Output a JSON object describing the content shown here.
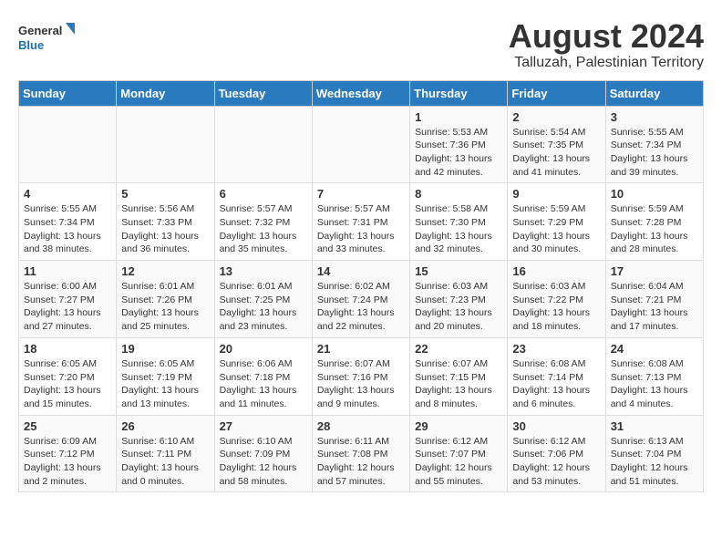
{
  "logo": {
    "line1": "General",
    "line2": "Blue"
  },
  "title": "August 2024",
  "subtitle": "Talluzah, Palestinian Territory",
  "days_of_week": [
    "Sunday",
    "Monday",
    "Tuesday",
    "Wednesday",
    "Thursday",
    "Friday",
    "Saturday"
  ],
  "weeks": [
    [
      {
        "day": "",
        "info": ""
      },
      {
        "day": "",
        "info": ""
      },
      {
        "day": "",
        "info": ""
      },
      {
        "day": "",
        "info": ""
      },
      {
        "day": "1",
        "info": "Sunrise: 5:53 AM\nSunset: 7:36 PM\nDaylight: 13 hours\nand 42 minutes."
      },
      {
        "day": "2",
        "info": "Sunrise: 5:54 AM\nSunset: 7:35 PM\nDaylight: 13 hours\nand 41 minutes."
      },
      {
        "day": "3",
        "info": "Sunrise: 5:55 AM\nSunset: 7:34 PM\nDaylight: 13 hours\nand 39 minutes."
      }
    ],
    [
      {
        "day": "4",
        "info": "Sunrise: 5:55 AM\nSunset: 7:34 PM\nDaylight: 13 hours\nand 38 minutes."
      },
      {
        "day": "5",
        "info": "Sunrise: 5:56 AM\nSunset: 7:33 PM\nDaylight: 13 hours\nand 36 minutes."
      },
      {
        "day": "6",
        "info": "Sunrise: 5:57 AM\nSunset: 7:32 PM\nDaylight: 13 hours\nand 35 minutes."
      },
      {
        "day": "7",
        "info": "Sunrise: 5:57 AM\nSunset: 7:31 PM\nDaylight: 13 hours\nand 33 minutes."
      },
      {
        "day": "8",
        "info": "Sunrise: 5:58 AM\nSunset: 7:30 PM\nDaylight: 13 hours\nand 32 minutes."
      },
      {
        "day": "9",
        "info": "Sunrise: 5:59 AM\nSunset: 7:29 PM\nDaylight: 13 hours\nand 30 minutes."
      },
      {
        "day": "10",
        "info": "Sunrise: 5:59 AM\nSunset: 7:28 PM\nDaylight: 13 hours\nand 28 minutes."
      }
    ],
    [
      {
        "day": "11",
        "info": "Sunrise: 6:00 AM\nSunset: 7:27 PM\nDaylight: 13 hours\nand 27 minutes."
      },
      {
        "day": "12",
        "info": "Sunrise: 6:01 AM\nSunset: 7:26 PM\nDaylight: 13 hours\nand 25 minutes."
      },
      {
        "day": "13",
        "info": "Sunrise: 6:01 AM\nSunset: 7:25 PM\nDaylight: 13 hours\nand 23 minutes."
      },
      {
        "day": "14",
        "info": "Sunrise: 6:02 AM\nSunset: 7:24 PM\nDaylight: 13 hours\nand 22 minutes."
      },
      {
        "day": "15",
        "info": "Sunrise: 6:03 AM\nSunset: 7:23 PM\nDaylight: 13 hours\nand 20 minutes."
      },
      {
        "day": "16",
        "info": "Sunrise: 6:03 AM\nSunset: 7:22 PM\nDaylight: 13 hours\nand 18 minutes."
      },
      {
        "day": "17",
        "info": "Sunrise: 6:04 AM\nSunset: 7:21 PM\nDaylight: 13 hours\nand 17 minutes."
      }
    ],
    [
      {
        "day": "18",
        "info": "Sunrise: 6:05 AM\nSunset: 7:20 PM\nDaylight: 13 hours\nand 15 minutes."
      },
      {
        "day": "19",
        "info": "Sunrise: 6:05 AM\nSunset: 7:19 PM\nDaylight: 13 hours\nand 13 minutes."
      },
      {
        "day": "20",
        "info": "Sunrise: 6:06 AM\nSunset: 7:18 PM\nDaylight: 13 hours\nand 11 minutes."
      },
      {
        "day": "21",
        "info": "Sunrise: 6:07 AM\nSunset: 7:16 PM\nDaylight: 13 hours\nand 9 minutes."
      },
      {
        "day": "22",
        "info": "Sunrise: 6:07 AM\nSunset: 7:15 PM\nDaylight: 13 hours\nand 8 minutes."
      },
      {
        "day": "23",
        "info": "Sunrise: 6:08 AM\nSunset: 7:14 PM\nDaylight: 13 hours\nand 6 minutes."
      },
      {
        "day": "24",
        "info": "Sunrise: 6:08 AM\nSunset: 7:13 PM\nDaylight: 13 hours\nand 4 minutes."
      }
    ],
    [
      {
        "day": "25",
        "info": "Sunrise: 6:09 AM\nSunset: 7:12 PM\nDaylight: 13 hours\nand 2 minutes."
      },
      {
        "day": "26",
        "info": "Sunrise: 6:10 AM\nSunset: 7:11 PM\nDaylight: 13 hours\nand 0 minutes."
      },
      {
        "day": "27",
        "info": "Sunrise: 6:10 AM\nSunset: 7:09 PM\nDaylight: 12 hours\nand 58 minutes."
      },
      {
        "day": "28",
        "info": "Sunrise: 6:11 AM\nSunset: 7:08 PM\nDaylight: 12 hours\nand 57 minutes."
      },
      {
        "day": "29",
        "info": "Sunrise: 6:12 AM\nSunset: 7:07 PM\nDaylight: 12 hours\nand 55 minutes."
      },
      {
        "day": "30",
        "info": "Sunrise: 6:12 AM\nSunset: 7:06 PM\nDaylight: 12 hours\nand 53 minutes."
      },
      {
        "day": "31",
        "info": "Sunrise: 6:13 AM\nSunset: 7:04 PM\nDaylight: 12 hours\nand 51 minutes."
      }
    ]
  ]
}
